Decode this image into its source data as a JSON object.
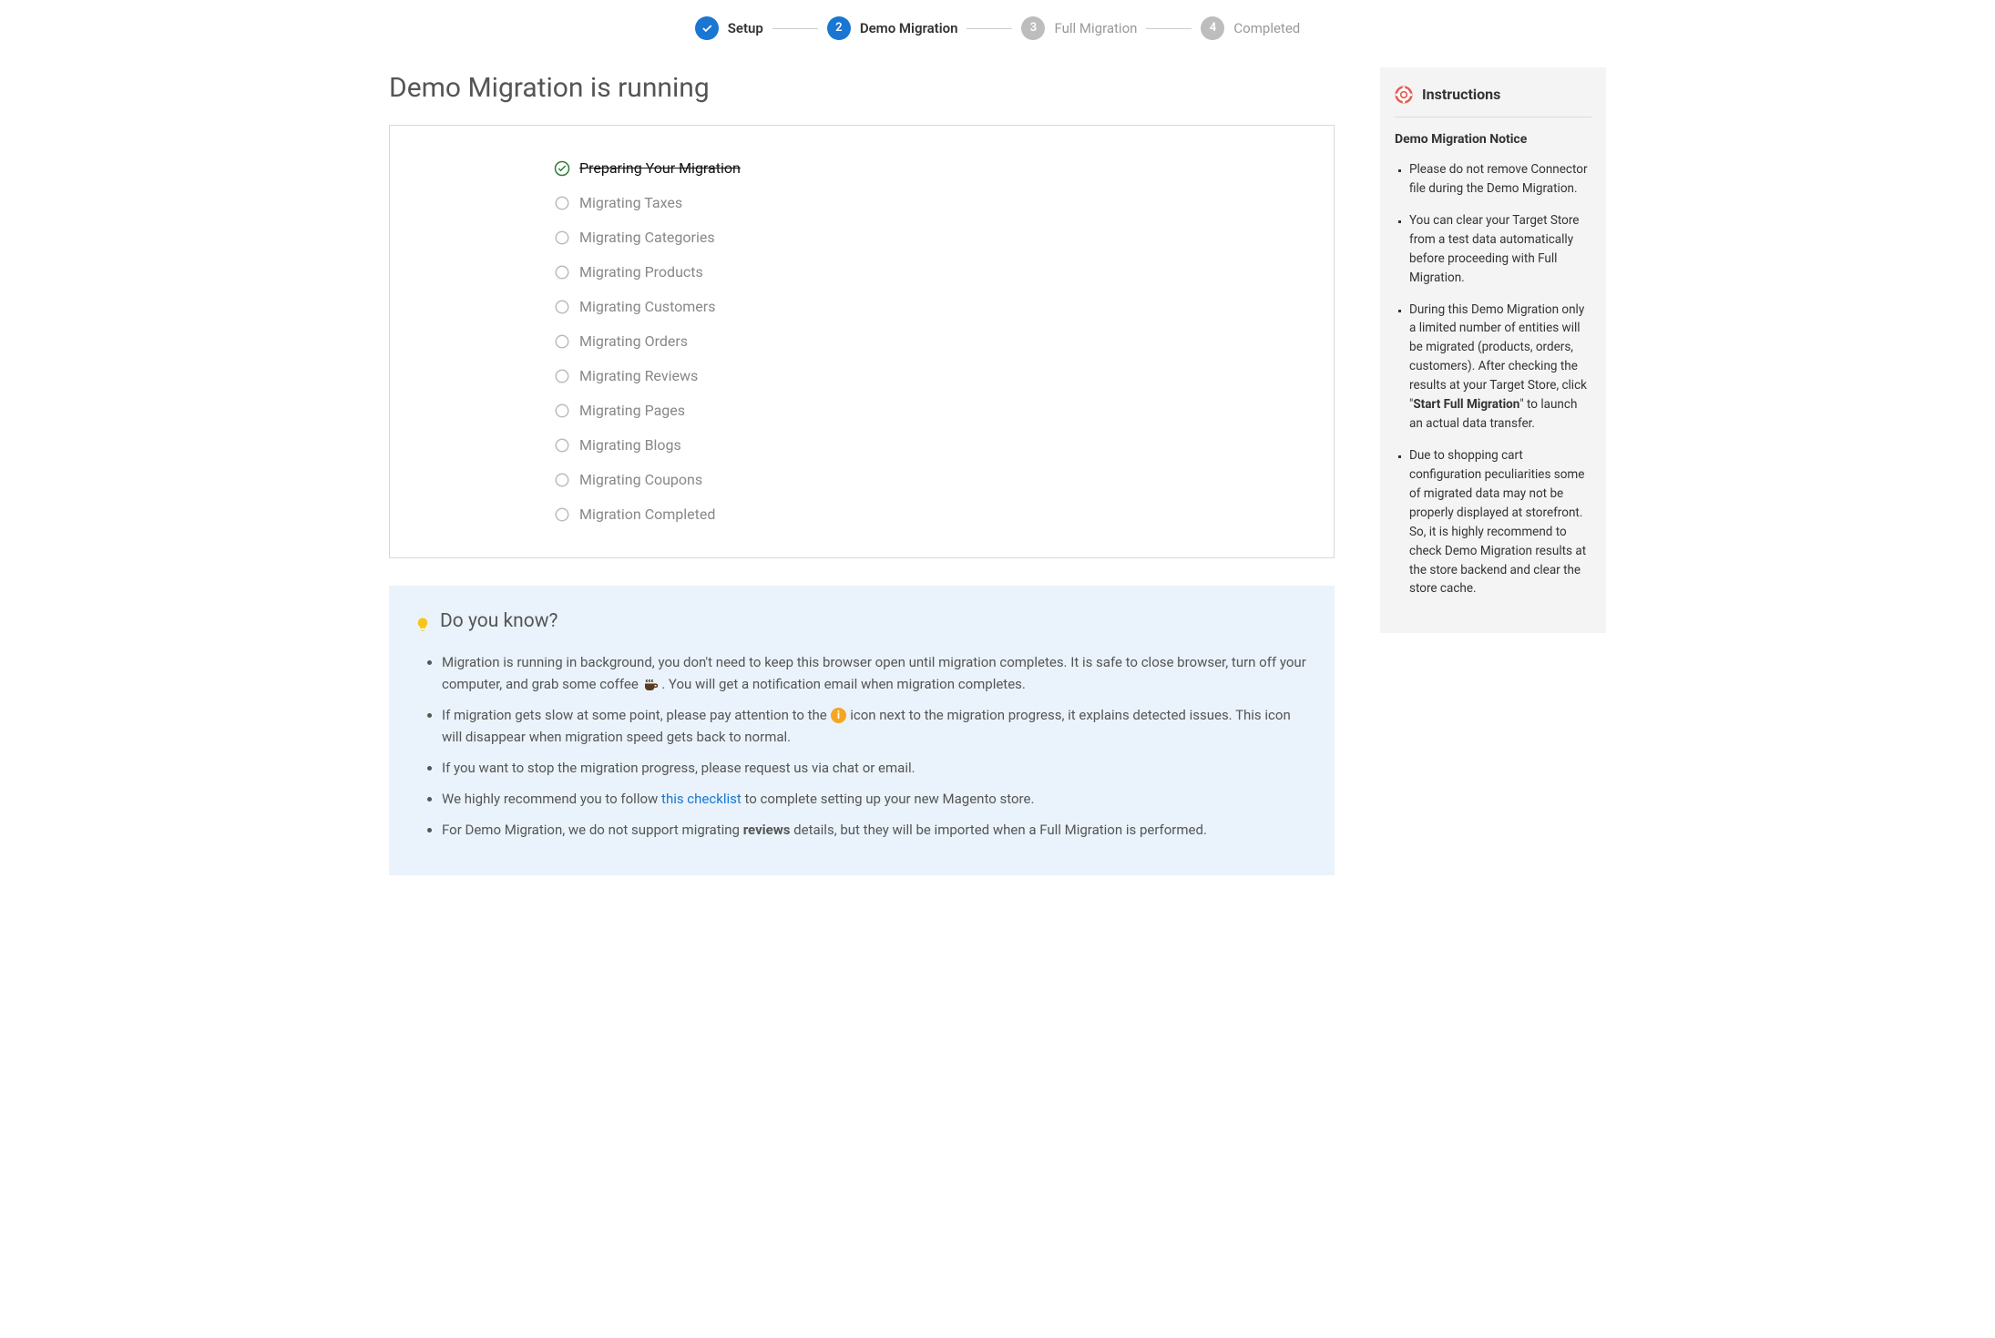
{
  "stepper": {
    "steps": [
      {
        "label": "Setup",
        "state": "done"
      },
      {
        "label": "Demo Migration",
        "state": "active",
        "num": "2"
      },
      {
        "label": "Full Migration",
        "state": "inactive",
        "num": "3"
      },
      {
        "label": "Completed",
        "state": "inactive",
        "num": "4"
      }
    ]
  },
  "page_title": "Demo Migration is running",
  "progress": {
    "items": [
      {
        "label": "Preparing Your Migration",
        "state": "done"
      },
      {
        "label": "Migrating Taxes",
        "state": "pending"
      },
      {
        "label": "Migrating Categories",
        "state": "pending"
      },
      {
        "label": "Migrating Products",
        "state": "pending"
      },
      {
        "label": "Migrating Customers",
        "state": "pending"
      },
      {
        "label": "Migrating Orders",
        "state": "pending"
      },
      {
        "label": "Migrating Reviews",
        "state": "pending"
      },
      {
        "label": "Migrating Pages",
        "state": "pending"
      },
      {
        "label": "Migrating Blogs",
        "state": "pending"
      },
      {
        "label": "Migrating Coupons",
        "state": "pending"
      },
      {
        "label": "Migration Completed",
        "state": "pending"
      }
    ]
  },
  "tips": {
    "title": "Do you know?",
    "items": [
      {
        "pre": "Migration is running in background, you don't need to keep this browser open until migration completes. It is safe to close browser, turn off your computer, and grab some coffee ",
        "icon": "coffee",
        "post": " . You will get a notification email when migration completes."
      },
      {
        "pre": "If migration gets slow at some point, please pay attention to the ",
        "icon": "info",
        "post": " icon next to the migration progress, it explains detected issues. This icon will disappear when migration speed gets back to normal."
      },
      {
        "text": "If you want to stop the migration progress, please request us via chat or email."
      },
      {
        "pre": "We highly recommend you to follow ",
        "link_text": "this checklist",
        "post": " to complete setting up your new Magento store."
      },
      {
        "pre": "For Demo Migration, we do not support migrating ",
        "bold": "reviews",
        "post": " details, but they will be imported when a Full Migration is performed."
      }
    ]
  },
  "sidebar": {
    "title": "Instructions",
    "subtitle": "Demo Migration Notice",
    "items": [
      {
        "text": "Please do not remove Connector file during the Demo Migration."
      },
      {
        "text": "You can clear your Target Store from a test data automatically before proceeding with Full Migration."
      },
      {
        "pre": "During this Demo Migration only a limited number of entities will be migrated (products, orders, customers). After checking the results at your Target Store, click \"",
        "bold": "Start Full Migration",
        "post": "\" to launch an actual data transfer."
      },
      {
        "text": "Due to shopping cart configuration peculiarities some of migrated data may not be properly displayed at storefront. So, it is highly recommend to check Demo Migration results at the store backend and clear the store cache."
      }
    ]
  }
}
